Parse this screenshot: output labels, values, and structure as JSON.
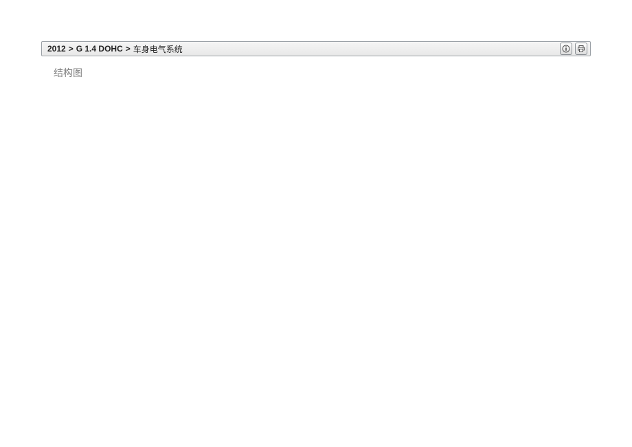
{
  "breadcrumb": {
    "year": "2012",
    "sep1": ">",
    "engine": "G 1.4 DOHC",
    "sep2": ">",
    "system": "车身电气系统"
  },
  "section": {
    "title": "结构图"
  },
  "icons": {
    "info": "info-icon",
    "print": "print-icon"
  }
}
